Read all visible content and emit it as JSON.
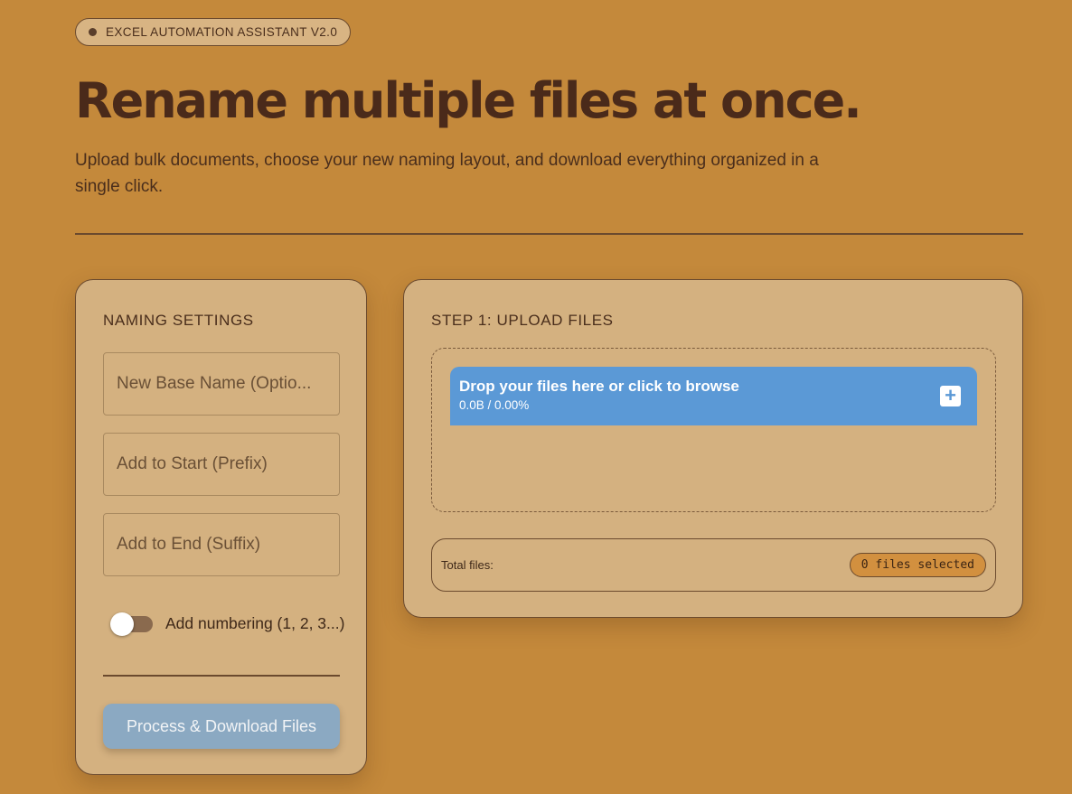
{
  "badge": {
    "label": "EXCEL AUTOMATION ASSISTANT V2.0"
  },
  "hero": {
    "title": "Rename multiple files at once.",
    "subtitle": "Upload bulk documents, choose your new naming layout, and download everything organized in a single click."
  },
  "settings": {
    "heading": "NAMING SETTINGS",
    "base_name_placeholder": "New Base Name (Optio...",
    "prefix_placeholder": "Add to Start (Prefix)",
    "suffix_placeholder": "Add to End (Suffix)",
    "numbering_label": "Add numbering (1, 2, 3...)",
    "numbering_enabled": false,
    "process_button": "Process & Download Files"
  },
  "upload": {
    "heading": "STEP 1: UPLOAD FILES",
    "drop_title": "Drop your files here or click to browse",
    "drop_size": "0.0B / 0.00%",
    "add_icon": "plus-icon",
    "total_label": "Total files:",
    "count_label": "0 files selected"
  },
  "colors": {
    "background": "#c4893b",
    "card": "#d4b180",
    "accent_blue": "#5b99d6",
    "button_disabled": "#8ba9c2",
    "text_dark": "#4a2a1a"
  }
}
